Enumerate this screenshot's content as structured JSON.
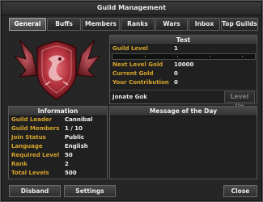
{
  "window": {
    "title": "Guild Management"
  },
  "tabs": [
    {
      "label": "General",
      "active": true
    },
    {
      "label": "Buffs",
      "active": false
    },
    {
      "label": "Members",
      "active": false
    },
    {
      "label": "Ranks",
      "active": false
    },
    {
      "label": "Wars",
      "active": false
    },
    {
      "label": "Inbox",
      "active": false
    },
    {
      "label": "Top Guilds",
      "active": false
    }
  ],
  "guild_panel": {
    "name": "Test",
    "guild_level_label": "Guild Level",
    "guild_level": "1",
    "level_progress": 0.0,
    "next_level_gold_label": "Next Level Gold",
    "next_level_gold": "10000",
    "current_gold_label": "Current Gold",
    "current_gold": "0",
    "your_contribution_label": "Your Contribution",
    "your_contribution": "0",
    "player_name": "Jonate Gok",
    "level_up_label": "Level Up"
  },
  "information": {
    "title": "Information",
    "rows": [
      {
        "label": "Guild Leader",
        "value": "Cannibal"
      },
      {
        "label": "Guild Members",
        "value": "1 / 10"
      },
      {
        "label": "Join Status",
        "value": "Public"
      },
      {
        "label": "Language",
        "value": "English"
      },
      {
        "label": "Required Level",
        "value": "50"
      },
      {
        "label": "Rank",
        "value": "2"
      },
      {
        "label": "Total Levels",
        "value": "500"
      }
    ]
  },
  "motd": {
    "title": "Message of the Day",
    "text": ""
  },
  "footer": {
    "disband_label": "Disband",
    "settings_label": "Settings",
    "close_label": "Close"
  },
  "colors": {
    "label_gold": "#d7a42a",
    "emblem_red": "#b0303a"
  },
  "icons": {
    "emblem": "dragon-shield-emblem-icon"
  }
}
